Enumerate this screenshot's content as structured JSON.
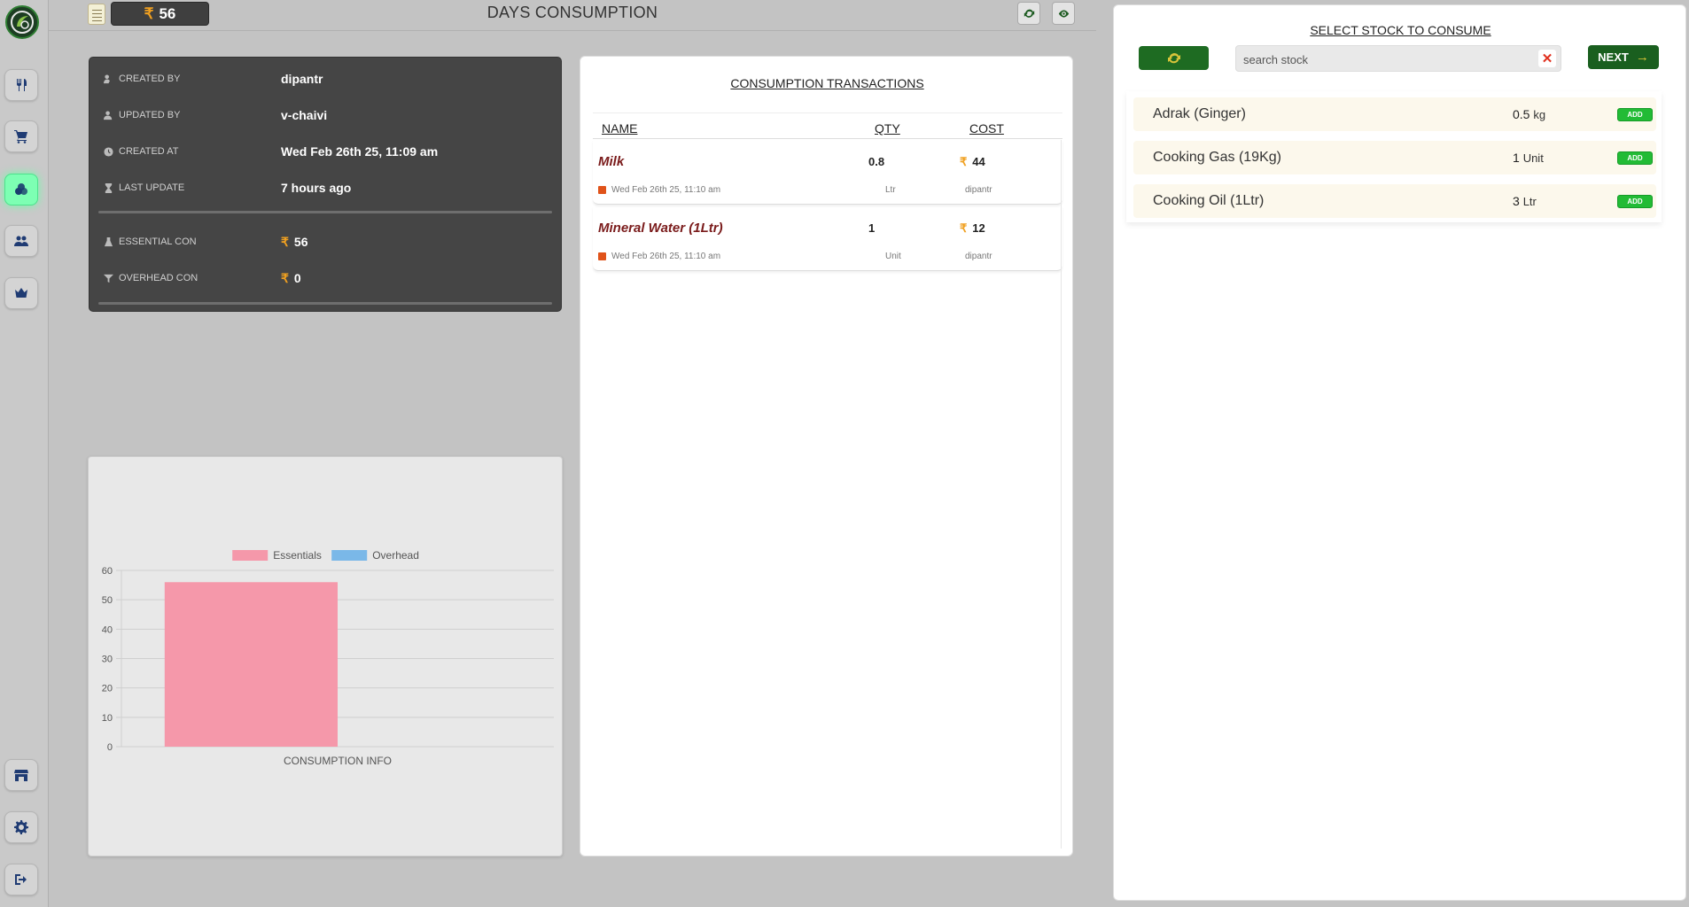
{
  "header": {
    "total_amount": "56",
    "currency_symbol": "₹",
    "title": "DAYS CONSUMPTION"
  },
  "info": {
    "created_by_label": "CREATED BY",
    "created_by": "dipantr",
    "updated_by_label": "UPDATED BY",
    "updated_by": "v-chaivi",
    "created_at_label": "CREATED AT",
    "created_at": "Wed Feb 26th 25, 11:09 am",
    "last_update_label": "LAST UPDATE",
    "last_update": "7 hours ago",
    "essential_label": "ESSENTIAL CON",
    "essential_value": "56",
    "overhead_label": "OVERHEAD CON",
    "overhead_value": "0"
  },
  "chart_data": {
    "type": "bar",
    "categories": [
      "CONSUMPTION INFO"
    ],
    "series": [
      {
        "name": "Essentials",
        "values": [
          56
        ],
        "color": "#f598aa"
      },
      {
        "name": "Overhead",
        "values": [
          0
        ],
        "color": "#7ab8e8"
      }
    ],
    "ylim": [
      0,
      60
    ],
    "yticks": [
      0,
      10,
      20,
      30,
      40,
      50,
      60
    ],
    "legend": "top",
    "grid": true
  },
  "transactions": {
    "title": "CONSUMPTION TRANSACTIONS",
    "columns": {
      "name": "NAME",
      "qty": "QTY",
      "cost": "COST"
    },
    "rows": [
      {
        "name": "Milk",
        "qty": "0.8",
        "cost": "44",
        "date": "Wed Feb 26th 25, 11:10 am",
        "unit": "Ltr",
        "user": "dipantr"
      },
      {
        "name": "Mineral Water (1Ltr)",
        "qty": "1",
        "cost": "12",
        "date": "Wed Feb 26th 25, 11:10 am",
        "unit": "Unit",
        "user": "dipantr"
      }
    ]
  },
  "stock": {
    "title": "SELECT STOCK TO CONSUME",
    "search_placeholder": "search stock",
    "next_label": "NEXT",
    "add_label": "ADD",
    "items": [
      {
        "name": "Adrak (Ginger)",
        "qty": "0.5",
        "unit": "kg"
      },
      {
        "name": "Cooking Gas (19Kg)",
        "qty": "1",
        "unit": "Unit"
      },
      {
        "name": "Cooking Oil (1Ltr)",
        "qty": "3",
        "unit": "Ltr"
      }
    ]
  },
  "colors": {
    "accent_green": "#1e6b22",
    "active_nav": "#7dffb3",
    "rupee": "#f0a020",
    "tx_name": "#7a1b1b"
  },
  "icons": {
    "sidebar": [
      "restaurant-icon",
      "cart-icon",
      "consumption-icon",
      "users-icon",
      "crown-icon",
      "store-icon",
      "gear-icon",
      "logout-icon"
    ]
  }
}
